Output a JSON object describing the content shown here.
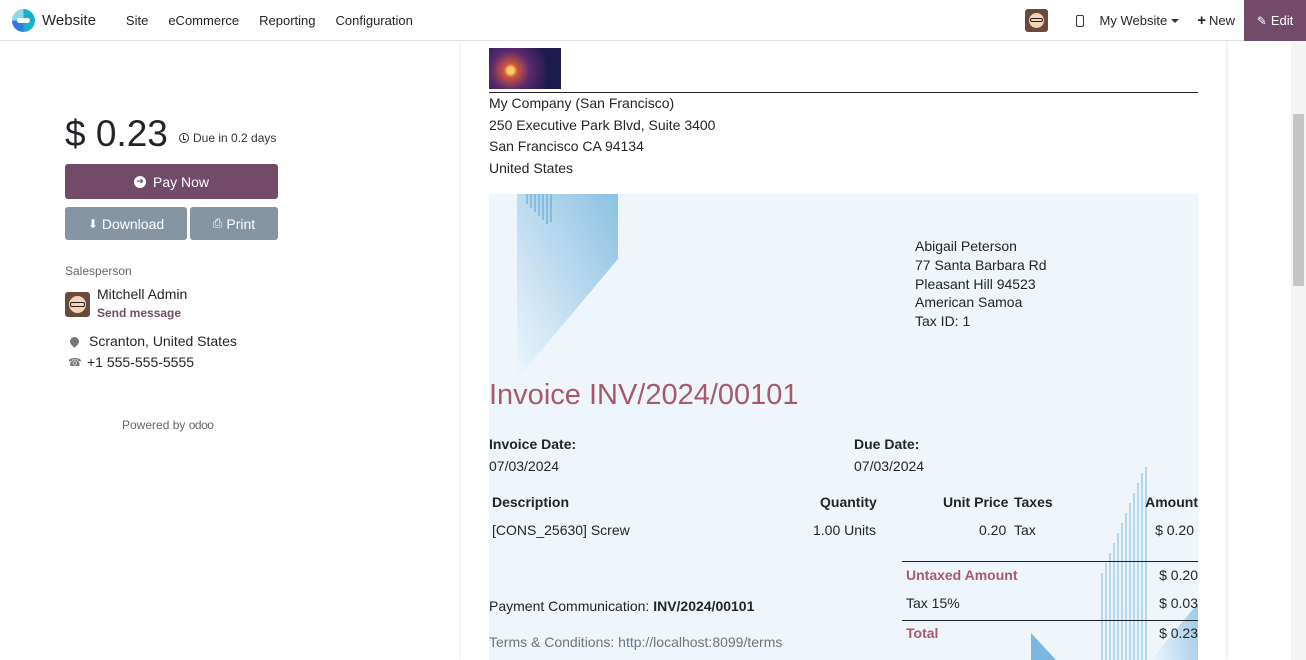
{
  "navbar": {
    "brand": "Website",
    "menu": [
      "Site",
      "eCommerce",
      "Reporting",
      "Configuration"
    ],
    "website_selector": "My Website",
    "new_label": "New",
    "edit_label": "Edit"
  },
  "sidebar": {
    "amount": "$ 0.23",
    "due_text": "Due in 0.2 days",
    "pay_now": "Pay Now",
    "download": "Download",
    "print": "Print",
    "salesperson_label": "Salesperson",
    "salesperson_name": "Mitchell Admin",
    "send_message": "Send message",
    "location": "Scranton, United States",
    "phone": "+1 555-555-5555",
    "powered_by": "Powered by",
    "powered_brand": "odoo"
  },
  "invoice": {
    "company": {
      "name": "My Company (San Francisco)",
      "street": "250 Executive Park Blvd, Suite 3400",
      "city": "San Francisco CA 94134",
      "country": "United States"
    },
    "partner": {
      "name": "Abigail Peterson",
      "street": "77 Santa Barbara Rd",
      "city": "Pleasant Hill 94523",
      "country": "American Samoa",
      "tax_id": "Tax ID: 1"
    },
    "title": "Invoice INV/2024/00101",
    "invoice_date_label": "Invoice Date:",
    "invoice_date": "07/03/2024",
    "due_date_label": "Due Date:",
    "due_date": "07/03/2024",
    "columns": {
      "description": "Description",
      "quantity": "Quantity",
      "unit_price": "Unit Price",
      "taxes": "Taxes",
      "amount": "Amount"
    },
    "lines": [
      {
        "description": "[CONS_25630] Screw",
        "quantity": "1.00 Units",
        "unit_price": "0.20",
        "taxes": "Tax",
        "amount": "$ 0.20"
      }
    ],
    "totals": {
      "untaxed_label": "Untaxed Amount",
      "untaxed_value": "$ 0.20",
      "tax_label": "Tax 15%",
      "tax_value": "$ 0.03",
      "total_label": "Total",
      "total_value": "$ 0.23"
    },
    "payment_communication_label": "Payment Communication:",
    "payment_communication_value": "INV/2024/00101",
    "terms": "Terms & Conditions: http://localhost:8099/terms"
  },
  "colors": {
    "brand_purple": "#714b67",
    "secondary_button": "#8595a2",
    "invoice_accent": "#a85a6a",
    "invoice_background": "#eef6fc"
  }
}
